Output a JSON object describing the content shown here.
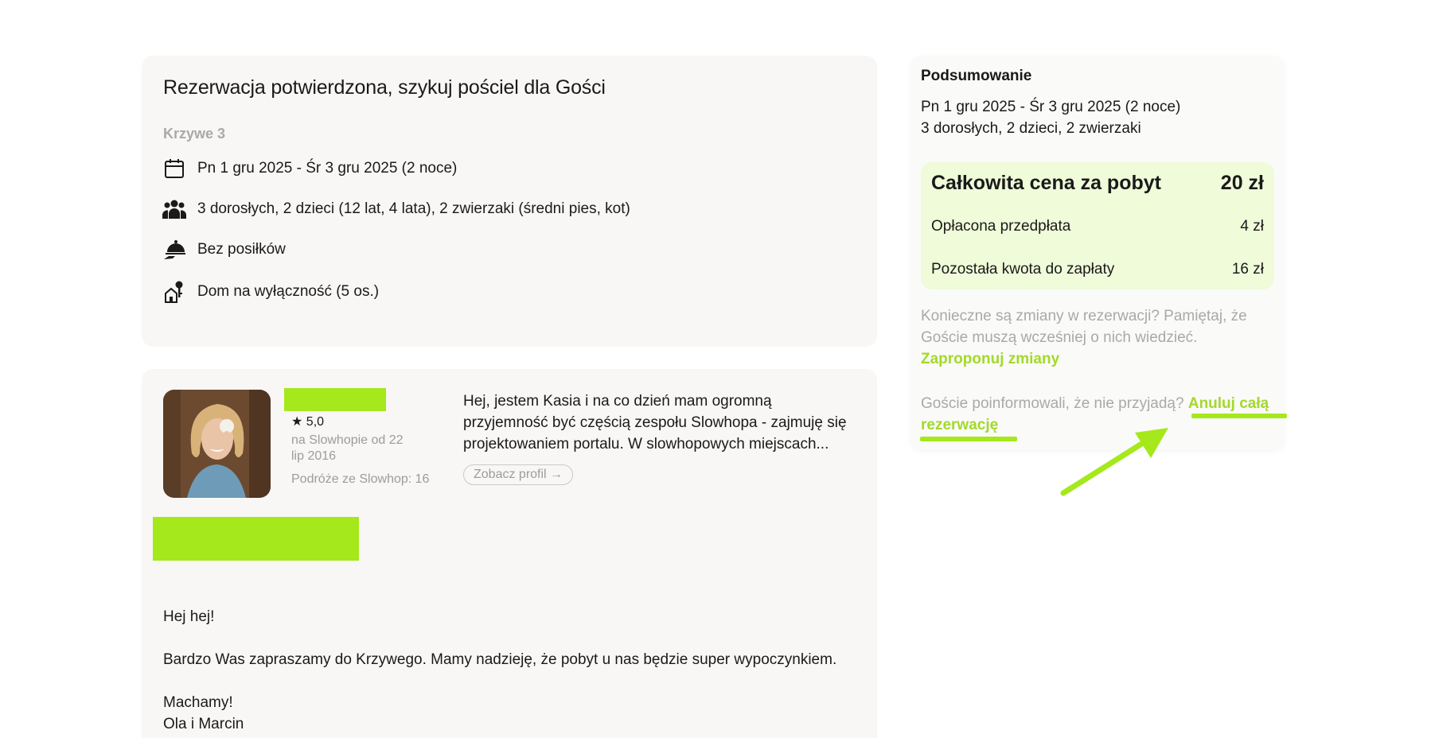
{
  "booking": {
    "title": "Rezerwacja potwierdzona, szykuj pościel dla Gości",
    "place": "Krzywe 3",
    "dates": "Pn 1 gru 2025 - Śr 3 gru 2025 (2 noce)",
    "guests": "3 dorosłych, 2 dzieci (12 lat, 4 lata), 2 zwierzaki (średni pies, kot)",
    "meals": "Bez posiłków",
    "accommodation": "Dom na wyłączność  (5 os.)"
  },
  "host": {
    "rating": "★ 5,0",
    "member_since": "na Slowhopie od 22 lip 2016",
    "trips": "Podróże ze Slowhop: 16",
    "bio": "Hej, jestem Kasia i na co dzień mam ogromną przyjemność być częścią zespołu Slowhopa - zajmuję się projektowaniem portalu. W slowhopowych miejscach...",
    "profile_button": "Zobacz profil →"
  },
  "message": {
    "greeting": "Hej hej!",
    "body": "Bardzo Was zapraszamy do Krzywego. Mamy nadzieję, że pobyt u nas będzie super wypoczynkiem.",
    "closing": "Machamy!",
    "signature": "Ola i Marcin"
  },
  "summary": {
    "title": "Podsumowanie",
    "dates": "Pn 1 gru 2025 - Śr 3 gru 2025 (2 noce)",
    "guests": "3 dorosłych, 2 dzieci, 2 zwierzaki",
    "total_label": "Całkowita cena za pobyt",
    "total_value": "20 zł",
    "prepaid_label": "Opłacona przedpłata",
    "prepaid_value": "4 zł",
    "remaining_label": "Pozostała kwota do zapłaty",
    "remaining_value": "16 zł",
    "changes_text": "Konieczne są zmiany w rezerwacji? Pamiętaj, że Goście muszą wcześniej o nich wiedzieć.",
    "changes_link": "Zaproponuj zmiany",
    "cancel_text": "Goście poinformowali, że nie przyjadą?",
    "cancel_link": "Anuluj całą rezerwację"
  },
  "colors": {
    "accent": "#a5e81c",
    "link": "#a3d92b",
    "price_box": "#effbd9",
    "card": "#f8f7f5",
    "muted_text": "#a9a9a9"
  },
  "icons": [
    "calendar-icon",
    "people-icon",
    "meal-cloche-icon",
    "house-key-icon",
    "star-icon",
    "arrow-right-icon"
  ]
}
